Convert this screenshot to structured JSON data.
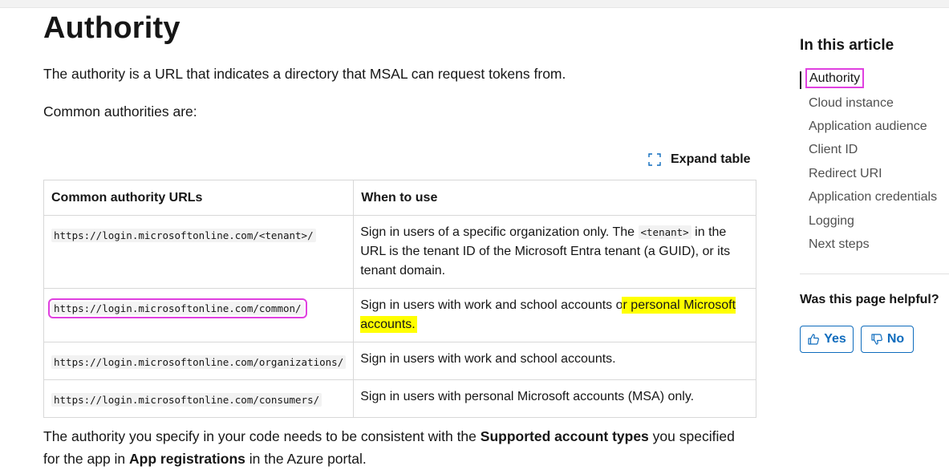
{
  "article": {
    "title": "Authority",
    "intro": "The authority is a URL that indicates a directory that MSAL can request tokens from.",
    "common_intro": "Common authorities are:",
    "expand_table": "Expand table",
    "table": {
      "headers": [
        "Common authority URLs",
        "When to use"
      ],
      "rows": [
        {
          "url": "https://login.microsoftonline.com/<tenant>/",
          "use_before": "Sign in users of a specific organization only. The ",
          "use_code": "<tenant>",
          "use_after": " in the URL is the tenant ID of the Microsoft Entra tenant (a GUID), or its tenant domain."
        },
        {
          "url": "https://login.microsoftonline.com/common/",
          "use_before": "Sign in users with work and school accounts o",
          "use_highlight": "r personal Microsoft accounts."
        },
        {
          "url": "https://login.microsoftonline.com/organizations/",
          "use": "Sign in users with work and school accounts."
        },
        {
          "url": "https://login.microsoftonline.com/consumers/",
          "use": "Sign in users with personal Microsoft accounts (MSA) only."
        }
      ]
    },
    "closing": {
      "t1": "The authority you specify in your code needs to be consistent with the ",
      "b1": "Supported account types",
      "t2": " you specified for the app in ",
      "b2": "App registrations",
      "t3": " in the Azure portal."
    }
  },
  "sidebar": {
    "title": "In this article",
    "items": [
      "Authority",
      "Cloud instance",
      "Application audience",
      "Client ID",
      "Redirect URI",
      "Application credentials",
      "Logging",
      "Next steps"
    ],
    "helpful": "Was this page helpful?",
    "yes": "Yes",
    "no": "No",
    "accent": "#0f6cbd",
    "highlight": "#ffff00",
    "annotation": "#e040e0"
  }
}
